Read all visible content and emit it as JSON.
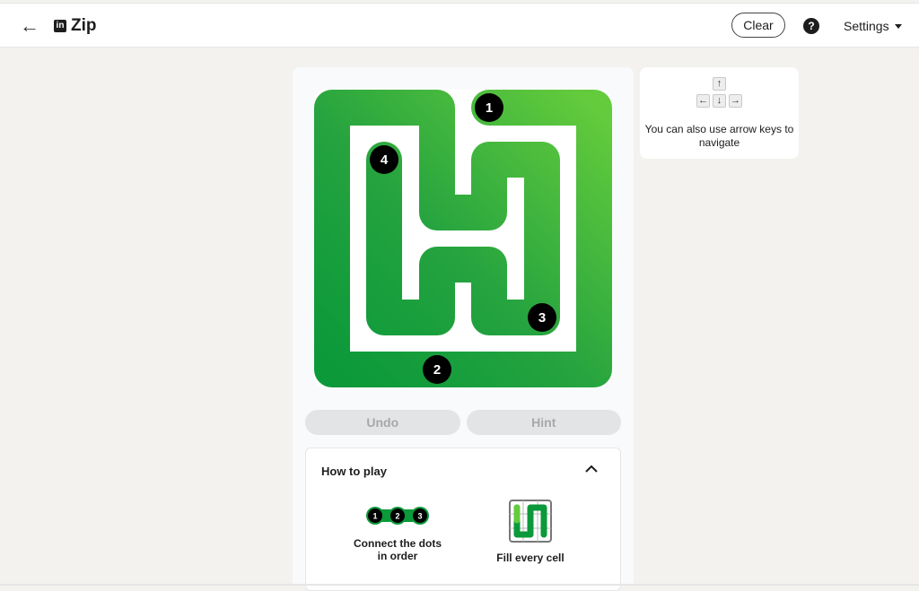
{
  "header": {
    "back_icon": "arrow-left-icon",
    "brand_logo": "linkedin-logo",
    "logo_text": "in",
    "title": "Zip",
    "clear_label": "Clear",
    "help_icon": "question-circle-icon",
    "help_text": "?",
    "settings_label": "Settings"
  },
  "board": {
    "dots": [
      {
        "label": "1"
      },
      {
        "label": "2"
      },
      {
        "label": "3"
      },
      {
        "label": "4"
      }
    ],
    "colors": {
      "path_light": "#63cb3c",
      "path_dark": "#0b993a",
      "board_bg": "#ffffff",
      "dot": "#000000"
    }
  },
  "controls": {
    "undo_label": "Undo",
    "hint_label": "Hint"
  },
  "how_to_play": {
    "title": "How to play",
    "rules": [
      {
        "label": "Connect the dots in order",
        "dots": [
          "1",
          "2",
          "3"
        ]
      },
      {
        "label": "Fill every cell"
      }
    ]
  },
  "tip": {
    "keys": {
      "up": "↑",
      "left": "←",
      "down": "↓",
      "right": "→"
    },
    "text": "You can also use arrow keys to navigate"
  }
}
